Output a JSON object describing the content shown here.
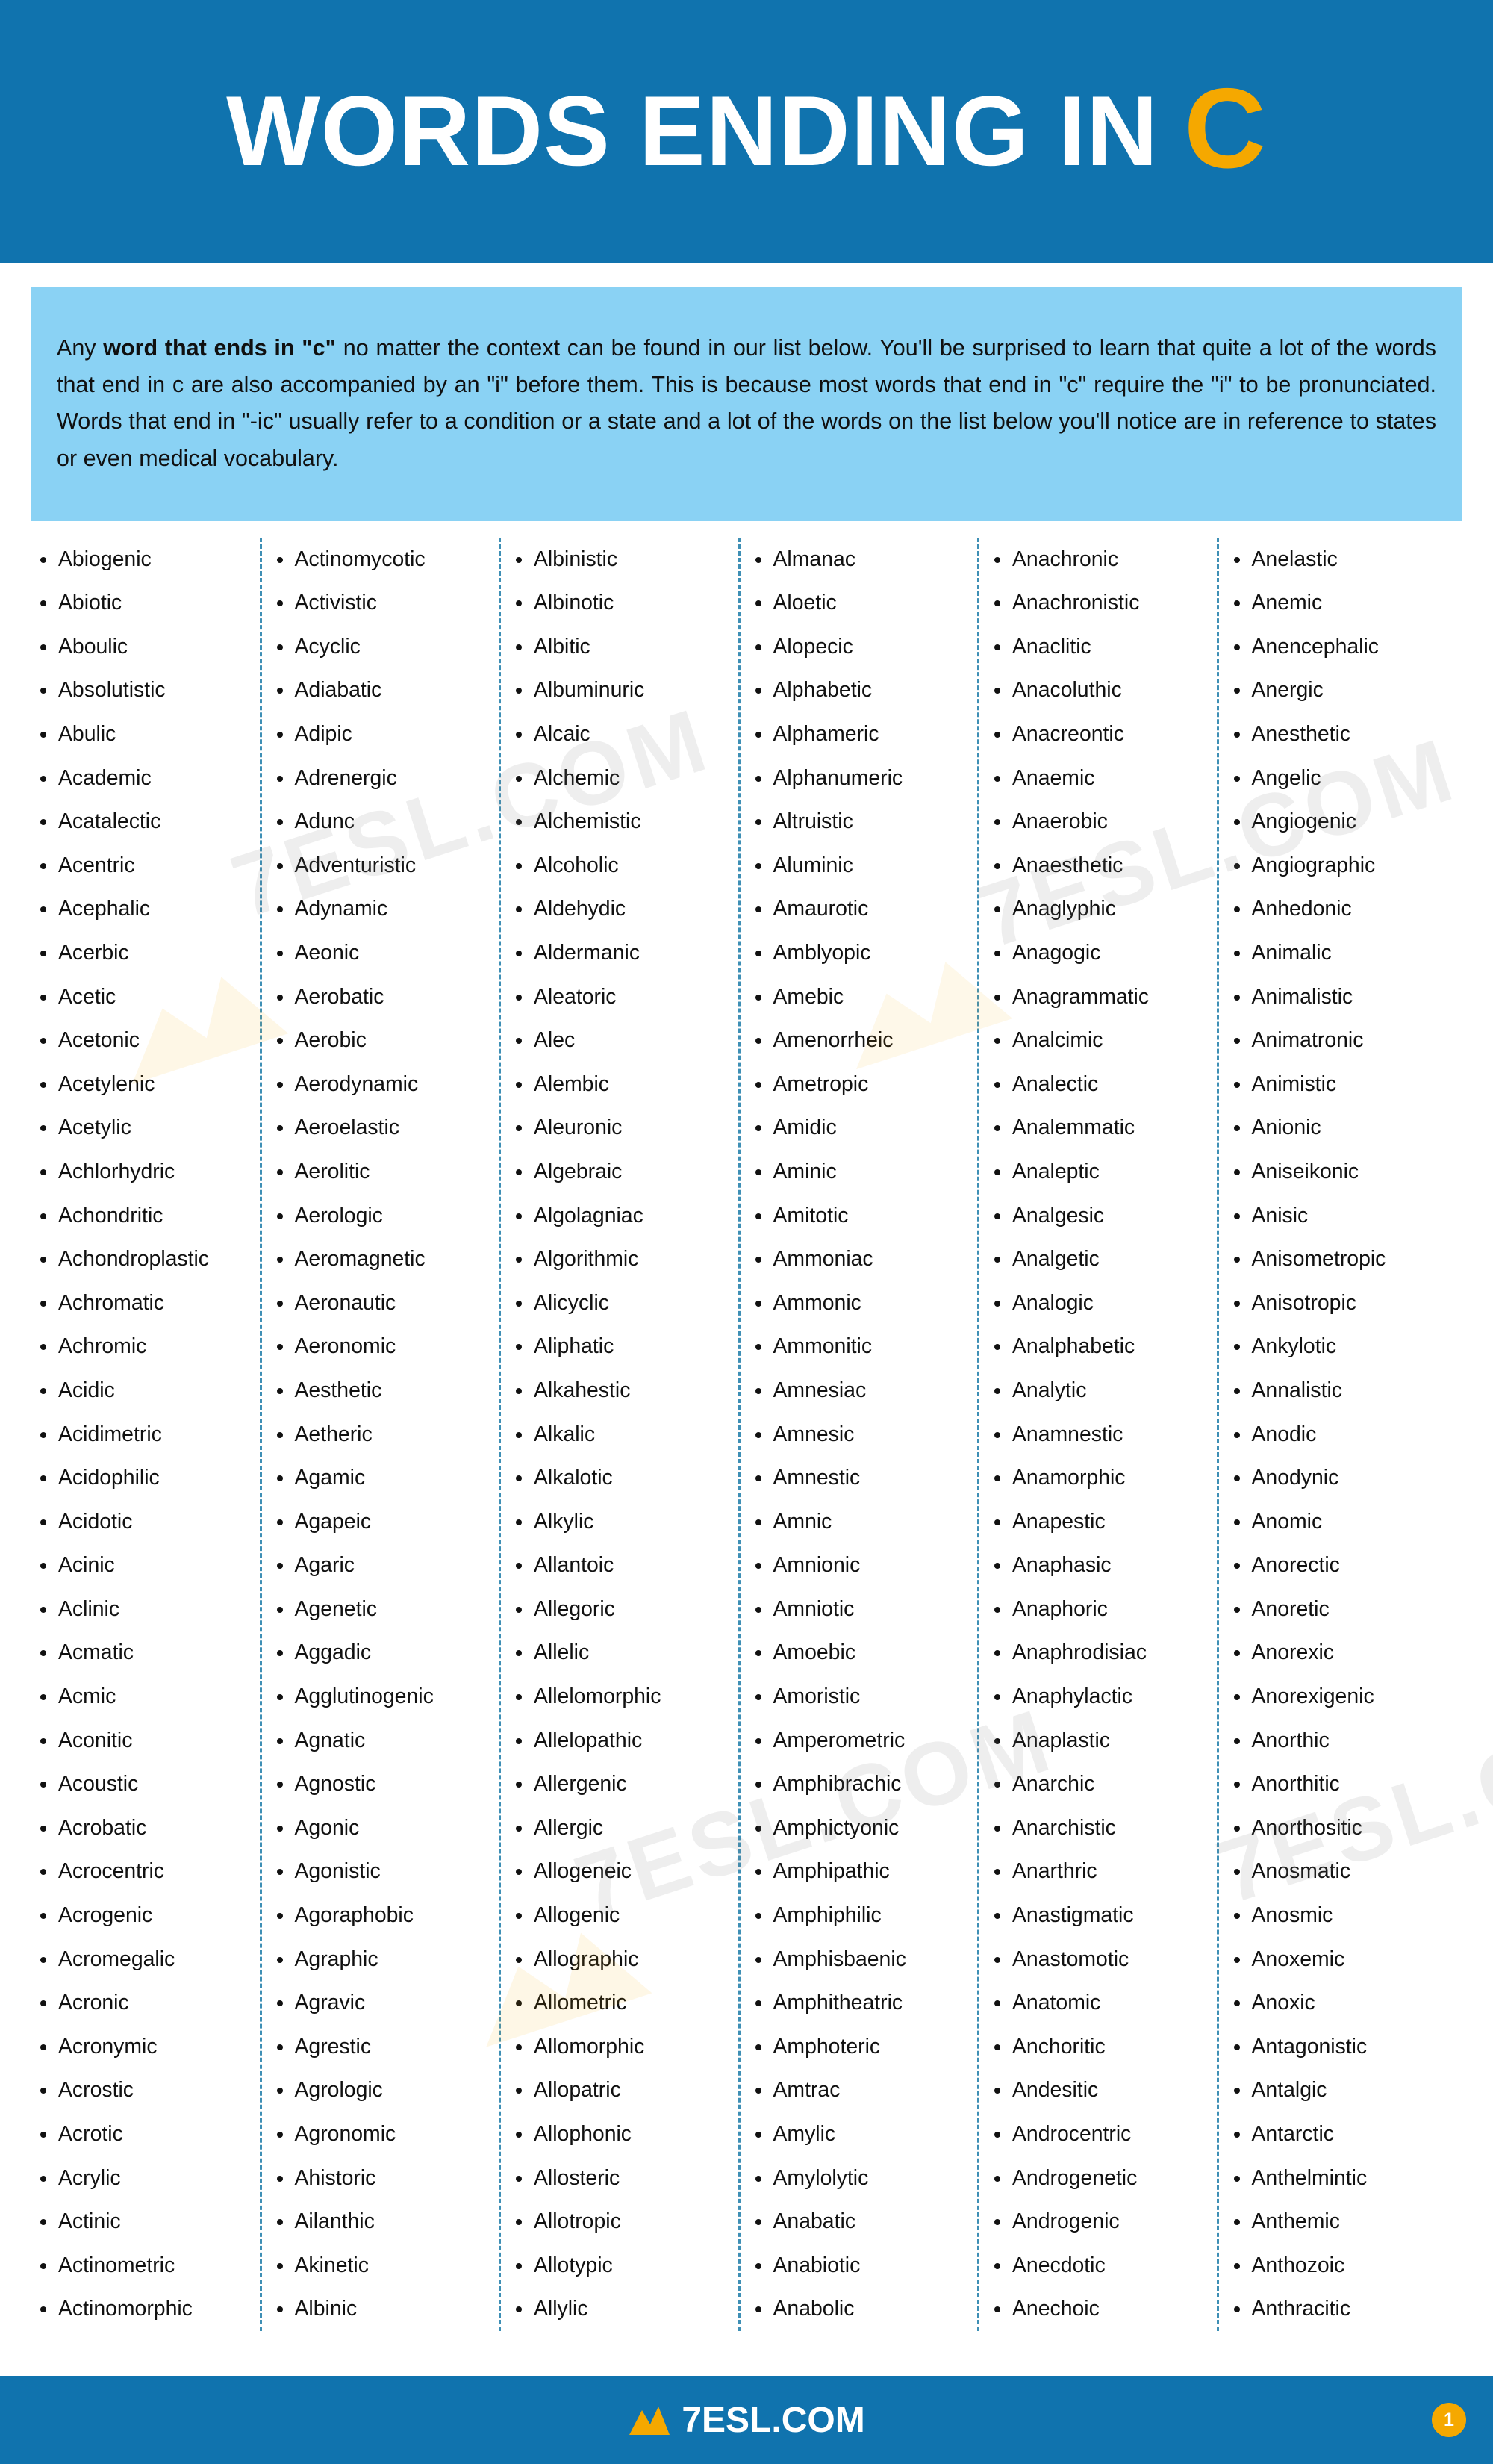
{
  "header": {
    "title_text": "WORDS ENDING IN",
    "title_letter": "C"
  },
  "intro": {
    "part1": "Any ",
    "bold": "word that ends in \"c\"",
    "part2": " no matter the context can be found in our list below. You'll be surprised to learn that quite a lot of the words that end in c are also accompanied by an \"i\" before them. This is because most words that end in \"c\" require the \"i\" to be pronunciated. Words that end in \"-ic\" usually refer to a condition or a state and a lot of the words on the list below you'll notice are in reference to states or even medical vocabulary."
  },
  "watermark": {
    "text": "7ESL.COM"
  },
  "footer": {
    "logo_text": "7ESL.COM",
    "page_number": "1"
  },
  "colors": {
    "header_blue": "#1073AE",
    "accent_yellow": "#F5A800",
    "intro_blue": "#8AD2F4",
    "divider": "#3E8FB5"
  },
  "columns": [
    {
      "id": "column-1",
      "words": [
        "Abiogenic",
        "Abiotic",
        "Aboulic",
        "Absolutistic",
        "Abulic",
        "Academic",
        "Acatalectic",
        "Acentric",
        "Acephalic",
        "Acerbic",
        "Acetic",
        "Acetonic",
        "Acetylenic",
        "Acetylic",
        "Achlorhydric",
        "Achondritic",
        "Achondroplastic",
        "Achromatic",
        "Achromic",
        "Acidic",
        "Acidimetric",
        "Acidophilic",
        "Acidotic",
        "Acinic",
        "Aclinic",
        "Acmatic",
        "Acmic",
        "Aconitic",
        "Acoustic",
        "Acrobatic",
        "Acrocentric",
        "Acrogenic",
        "Acromegalic",
        "Acronic",
        "Acronymic",
        "Acrostic",
        "Acrotic",
        "Acrylic",
        "Actinic",
        "Actinometric",
        "Actinomorphic"
      ]
    },
    {
      "id": "column-2",
      "words": [
        "Actinomycotic",
        "Activistic",
        "Acyclic",
        "Adiabatic",
        "Adipic",
        "Adrenergic",
        "Adunc",
        "Adventuristic",
        "Adynamic",
        "Aeonic",
        "Aerobatic",
        "Aerobic",
        "Aerodynamic",
        "Aeroelastic",
        "Aerolitic",
        "Aerologic",
        "Aeromagnetic",
        "Aeronautic",
        "Aeronomic",
        "Aesthetic",
        "Aetheric",
        "Agamic",
        "Agapeic",
        "Agaric",
        "Agenetic",
        "Aggadic",
        "Agglutinogenic",
        "Agnatic",
        "Agnostic",
        "Agonic",
        "Agonistic",
        "Agoraphobic",
        "Agraphic",
        "Agravic",
        "Agrestic",
        "Agrologic",
        "Agronomic",
        "Ahistoric",
        "Ailanthic",
        "Akinetic",
        "Albinic"
      ]
    },
    {
      "id": "column-3",
      "words": [
        "Albinistic",
        "Albinotic",
        "Albitic",
        "Albuminuric",
        "Alcaic",
        "Alchemic",
        "Alchemistic",
        "Alcoholic",
        "Aldehydic",
        "Aldermanic",
        "Aleatoric",
        "Alec",
        "Alembic",
        "Aleuronic",
        "Algebraic",
        "Algolagniac",
        "Algorithmic",
        "Alicyclic",
        "Aliphatic",
        "Alkahestic",
        "Alkalic",
        "Alkalotic",
        "Alkylic",
        "Allantoic",
        "Allegoric",
        "Allelic",
        "Allelomorphic",
        "Allelopathic",
        "Allergenic",
        "Allergic",
        "Allogeneic",
        "Allogenic",
        "Allographic",
        "Allometric",
        "Allomorphic",
        "Allopatric",
        "Allophonic",
        "Allosteric",
        "Allotropic",
        "Allotypic",
        "Allylic"
      ]
    },
    {
      "id": "column-4",
      "words": [
        "Almanac",
        "Aloetic",
        "Alopecic",
        "Alphabetic",
        "Alphameric",
        "Alphanumeric",
        "Altruistic",
        "Aluminic",
        "Amaurotic",
        "Amblyopic",
        "Amebic",
        "Amenorrheic",
        "Ametropic",
        "Amidic",
        "Aminic",
        "Amitotic",
        "Ammoniac",
        "Ammonic",
        "Ammonitic",
        "Amnesiac",
        "Amnesic",
        "Amnestic",
        "Amnic",
        "Amnionic",
        "Amniotic",
        "Amoebic",
        "Amoristic",
        "Amperometric",
        "Amphibrachic",
        "Amphictyonic",
        "Amphipathic",
        "Amphiphilic",
        "Amphisbaenic",
        "Amphitheatric",
        "Amphoteric",
        "Amtrac",
        "Amylic",
        "Amylolytic",
        "Anabatic",
        "Anabiotic",
        "Anabolic"
      ]
    },
    {
      "id": "column-5",
      "words": [
        "Anachronic",
        "Anachronistic",
        "Anaclitic",
        "Anacoluthic",
        "Anacreontic",
        "Anaemic",
        "Anaerobic",
        "Anaesthetic",
        "Anaglyphic",
        "Anagogic",
        "Anagrammatic",
        "Analcimic",
        "Analectic",
        "Analemmatic",
        "Analeptic",
        "Analgesic",
        "Analgetic",
        "Analogic",
        "Analphabetic",
        "Analytic",
        "Anamnestic",
        "Anamorphic",
        "Anapestic",
        "Anaphasic",
        "Anaphoric",
        "Anaphrodisiac",
        "Anaphylactic",
        "Anaplastic",
        "Anarchic",
        "Anarchistic",
        "Anarthric",
        "Anastigmatic",
        "Anastomotic",
        "Anatomic",
        "Anchoritic",
        "Andesitic",
        "Androcentric",
        "Androgenetic",
        "Androgenic",
        "Anecdotic",
        "Anechoic"
      ]
    },
    {
      "id": "column-6",
      "words": [
        "Anelastic",
        "Anemic",
        "Anencephalic",
        "Anergic",
        "Anesthetic",
        "Angelic",
        "Angiogenic",
        "Angiographic",
        "Anhedonic",
        "Animalic",
        "Animalistic",
        "Animatronic",
        "Animistic",
        "Anionic",
        "Aniseikonic",
        "Anisic",
        "Anisometropic",
        "Anisotropic",
        "Ankylotic",
        "Annalistic",
        "Anodic",
        "Anodynic",
        "Anomic",
        "Anorectic",
        "Anoretic",
        "Anorexic",
        "Anorexigenic",
        "Anorthic",
        "Anorthitic",
        "Anorthositic",
        "Anosmatic",
        "Anosmic",
        "Anoxemic",
        "Anoxic",
        "Antagonistic",
        "Antalgic",
        "Antarctic",
        "Anthelmintic",
        "Anthemic",
        "Anthozoic",
        "Anthracitic"
      ]
    }
  ]
}
